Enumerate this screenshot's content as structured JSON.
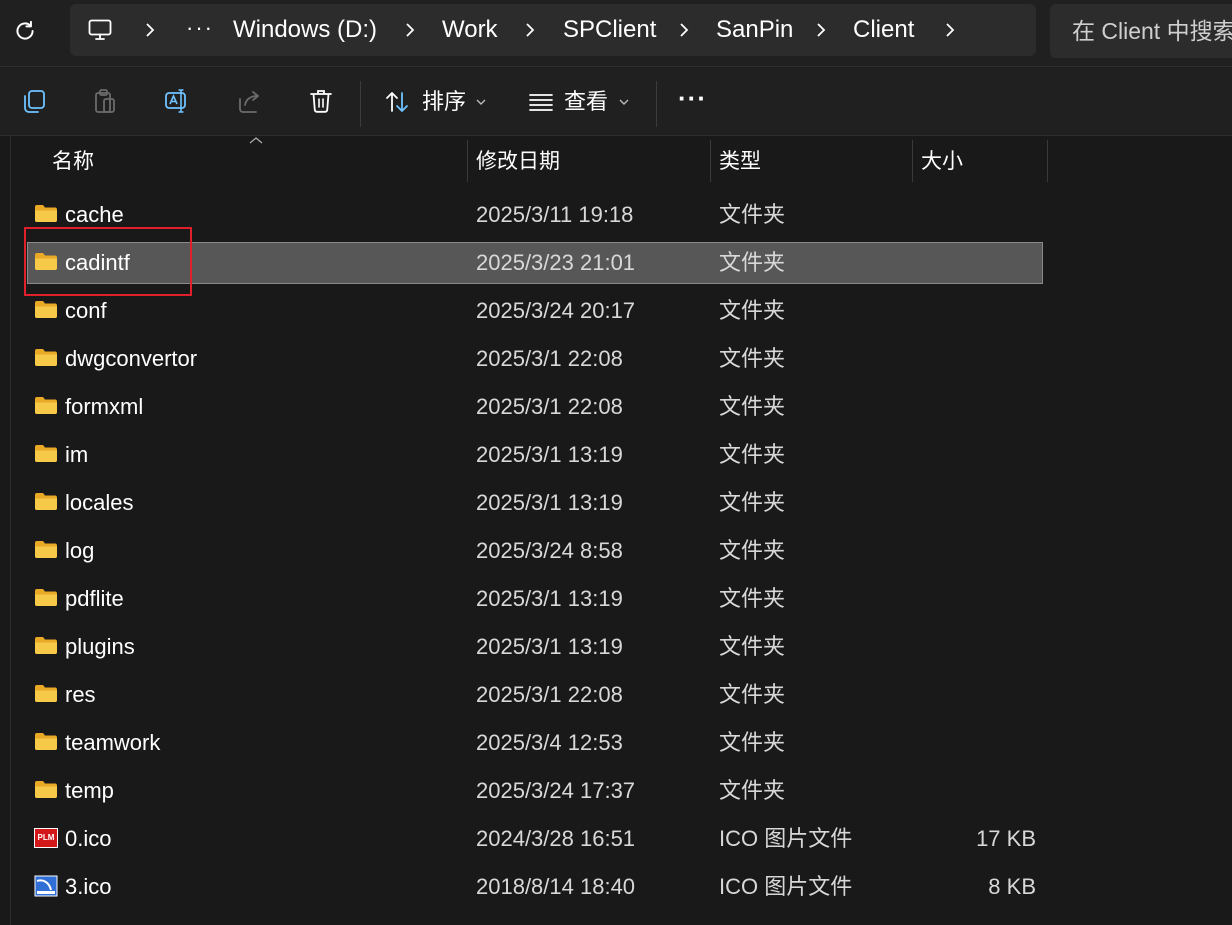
{
  "address_bar": {
    "more": "···",
    "crumbs": [
      "Windows (D:)",
      "Work",
      "SPClient",
      "SanPin",
      "Client"
    ],
    "search_placeholder": "在 Client 中搜索"
  },
  "command_bar": {
    "sort_label": "排序",
    "view_label": "查看",
    "more_label": "···"
  },
  "columns": {
    "name": "名称",
    "modified": "修改日期",
    "type": "类型",
    "size": "大小"
  },
  "rows": [
    {
      "name": "cache",
      "modified": "2025/3/11 19:18",
      "type": "文件夹",
      "size": "",
      "icon": "folder-icon"
    },
    {
      "name": "cadintf",
      "modified": "2025/3/23 21:01",
      "type": "文件夹",
      "size": "",
      "icon": "folder-icon"
    },
    {
      "name": "conf",
      "modified": "2025/3/24 20:17",
      "type": "文件夹",
      "size": "",
      "icon": "folder-icon"
    },
    {
      "name": "dwgconvertor",
      "modified": "2025/3/1 22:08",
      "type": "文件夹",
      "size": "",
      "icon": "folder-icon"
    },
    {
      "name": "formxml",
      "modified": "2025/3/1 22:08",
      "type": "文件夹",
      "size": "",
      "icon": "folder-icon"
    },
    {
      "name": "im",
      "modified": "2025/3/1 13:19",
      "type": "文件夹",
      "size": "",
      "icon": "folder-icon"
    },
    {
      "name": "locales",
      "modified": "2025/3/1 13:19",
      "type": "文件夹",
      "size": "",
      "icon": "folder-icon"
    },
    {
      "name": "log",
      "modified": "2025/3/24 8:58",
      "type": "文件夹",
      "size": "",
      "icon": "folder-icon"
    },
    {
      "name": "pdflite",
      "modified": "2025/3/1 13:19",
      "type": "文件夹",
      "size": "",
      "icon": "folder-icon"
    },
    {
      "name": "plugins",
      "modified": "2025/3/1 13:19",
      "type": "文件夹",
      "size": "",
      "icon": "folder-icon"
    },
    {
      "name": "res",
      "modified": "2025/3/1 22:08",
      "type": "文件夹",
      "size": "",
      "icon": "folder-icon"
    },
    {
      "name": "teamwork",
      "modified": "2025/3/4 12:53",
      "type": "文件夹",
      "size": "",
      "icon": "folder-icon"
    },
    {
      "name": "temp",
      "modified": "2025/3/24 17:37",
      "type": "文件夹",
      "size": "",
      "icon": "folder-icon"
    },
    {
      "name": "0.ico",
      "modified": "2024/3/28 16:51",
      "type": "ICO 图片文件",
      "size": "17 KB",
      "icon": "plm-ico-icon",
      "icon_text": "PLM"
    },
    {
      "name": "3.ico",
      "modified": "2018/8/14 18:40",
      "type": "ICO 图片文件",
      "size": "8 KB",
      "icon": "blue-ico-icon"
    }
  ],
  "colors": {
    "background": "#191919",
    "selection": "#575757",
    "folder": "#f5c342",
    "highlight_box": "#e0202a"
  }
}
